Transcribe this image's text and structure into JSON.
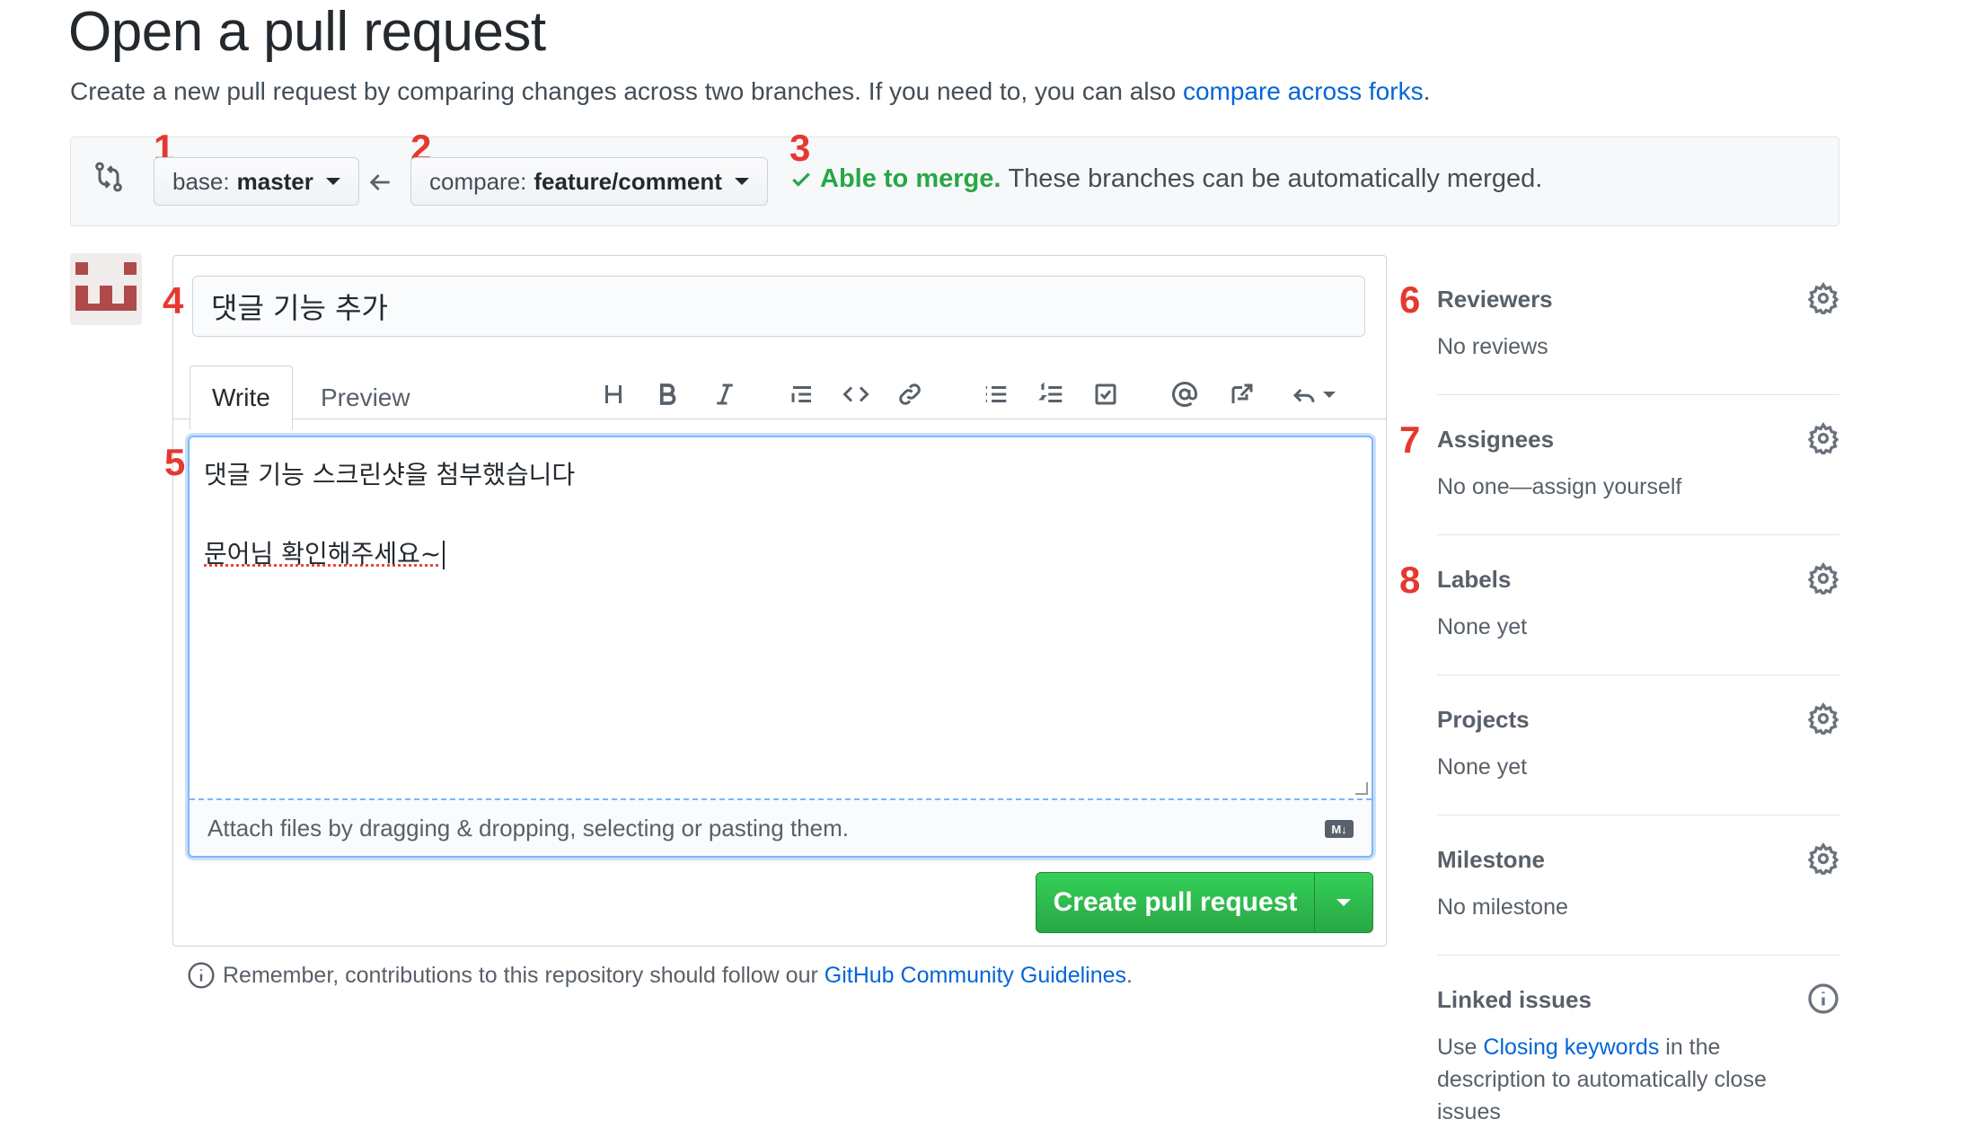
{
  "header": {
    "title": "Open a pull request",
    "subtitle_prefix": "Create a new pull request by comparing changes across two branches. If you need to, you can also ",
    "subtitle_link": "compare across forks",
    "subtitle_suffix": "."
  },
  "range": {
    "base_label": "base: ",
    "base_branch": "master",
    "compare_label": "compare: ",
    "compare_branch": "feature/comment",
    "merge_status": "Able to merge.",
    "merge_message": " These branches can be automatically merged."
  },
  "markers": [
    "1",
    "2",
    "3",
    "4",
    "5",
    "6",
    "7",
    "8"
  ],
  "composer": {
    "title_value": "댓글 기능 추가",
    "tab_write": "Write",
    "tab_preview": "Preview",
    "body_line1": "댓글 기능 스크린샷을 첨부했습니다",
    "body_line2": "",
    "body_line3": "문어님 확인해주세요~",
    "attach_hint": "Attach files by dragging & dropping, selecting or pasting them.",
    "md_badge": "M↓",
    "create_button": "Create pull request"
  },
  "remember": {
    "prefix": "Remember, contributions to this repository should follow our ",
    "link": "GitHub Community Guidelines",
    "suffix": "."
  },
  "sidebar": {
    "reviewers": {
      "heading": "Reviewers",
      "value": "No reviews"
    },
    "assignees": {
      "heading": "Assignees",
      "value": "No one—assign yourself"
    },
    "labels": {
      "heading": "Labels",
      "value": "None yet"
    },
    "projects": {
      "heading": "Projects",
      "value": "None yet"
    },
    "milestone": {
      "heading": "Milestone",
      "value": "No milestone"
    },
    "linked_issues": {
      "heading": "Linked issues",
      "use": "Use ",
      "link": "Closing keywords",
      "line1_suffix": " in the",
      "line2": "description to automatically close",
      "line3": "issues"
    }
  },
  "colors": {
    "link": "#0366d6",
    "merge_ok": "#28a745",
    "marker": "#e5392f",
    "button_green": "#28a745"
  }
}
